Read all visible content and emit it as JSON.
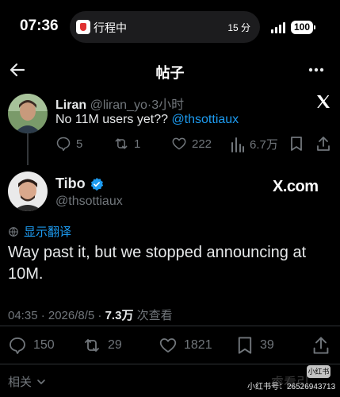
{
  "status_bar": {
    "time": "07:36",
    "live_activity_text": "行程中",
    "live_activity_eta": "15 分",
    "battery": "100"
  },
  "nav": {
    "title": "帖子"
  },
  "reply": {
    "name": "Liran",
    "handle": "@liran_yo",
    "time_ago": "3小时",
    "text_prefix": "No 11M users yet?? ",
    "mention": "@thsottiaux",
    "stats": {
      "replies": "5",
      "reposts": "1",
      "likes": "222",
      "views": "6.7万"
    }
  },
  "post": {
    "name": "Tibo",
    "handle": "@thsottiaux",
    "source_badge": "X.com",
    "translate_label": "显示翻译",
    "text": "Way past it, but we stopped announcing at 10M.",
    "timestamp": "04:35 · 2026/8/5 · ",
    "view_count": "7.3万",
    "view_label": " 次查看",
    "actions": {
      "replies": "150",
      "reposts": "29",
      "likes": "1821",
      "bookmarks": "39"
    }
  },
  "related_label": "相关",
  "watermark": {
    "badge": "小红书",
    "text": "小红书号：26526943713"
  },
  "colors": {
    "background": "#000000",
    "accent_blue": "#1d9bf0",
    "text_primary": "#e7e9ea",
    "text_secondary": "#71767b"
  }
}
